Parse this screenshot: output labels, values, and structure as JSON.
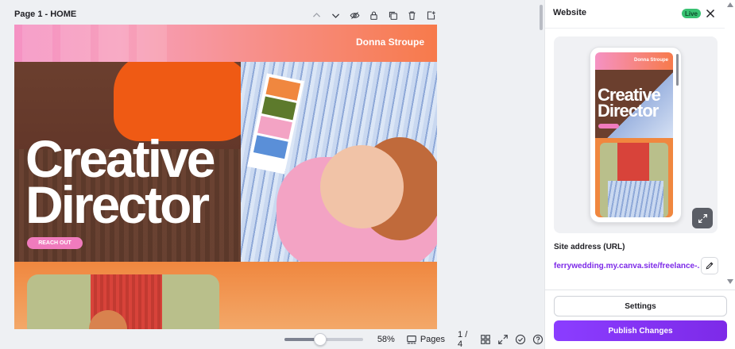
{
  "page": {
    "title": "Page 1 - HOME",
    "tool_icons": [
      "chevron-up-icon",
      "chevron-down-icon",
      "eye-hide-icon",
      "lock-icon",
      "duplicate-icon",
      "trash-icon",
      "add-page-icon"
    ]
  },
  "design": {
    "brand_name": "Donna Stroupe",
    "hero_title_line1": "Creative",
    "hero_title_line2": "Director",
    "cta_label": "REACH OUT",
    "colors": {
      "pink": "#f592c3",
      "orange": "#f77a4b",
      "brown": "#6b3f2e",
      "cta": "#f07bbd"
    }
  },
  "bottom_bar": {
    "zoom_fraction": 0.45,
    "zoom_label": "58%",
    "pages_label": "Pages",
    "page_counter": "1 / 4"
  },
  "panel": {
    "title": "Website",
    "live_badge": "Live",
    "preview": {
      "brand_name": "Donna Stroupe",
      "hero_title_line1": "Creative",
      "hero_title_line2": "Director"
    },
    "url_label": "Site address (URL)",
    "url_value": "ferrywedding.my.canva.site/freelance-...",
    "settings_label": "Settings",
    "publish_label": "Publish Changes",
    "accent_color": "#7d2ae8",
    "live_color": "#38c172"
  }
}
